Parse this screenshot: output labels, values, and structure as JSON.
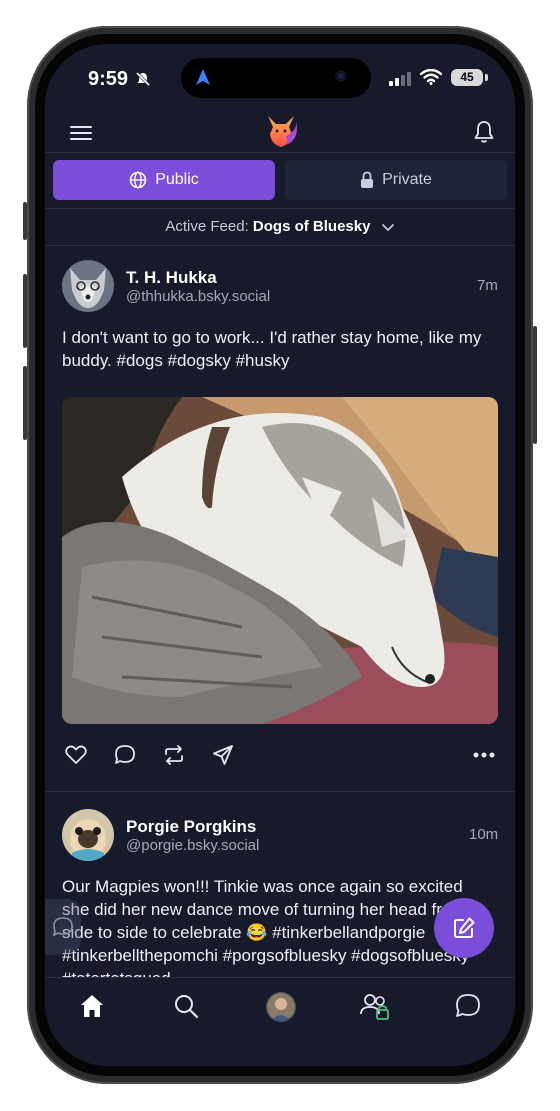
{
  "status_bar": {
    "time": "9:59",
    "battery": "45"
  },
  "header": {
    "logo_icon": "fox-logo-icon",
    "menu_icon": "hamburger-menu-icon",
    "bell_icon": "bell-icon"
  },
  "tabs": [
    {
      "label": "Public",
      "icon": "globe-icon",
      "selected": true
    },
    {
      "label": "Private",
      "icon": "lock-icon",
      "selected": false
    }
  ],
  "feed": {
    "prefix": "Active Feed:",
    "name": "Dogs of Bluesky"
  },
  "posts": [
    {
      "name": "T. H. Hukka",
      "handle": "@thhukka.bsky.social",
      "time": "7m",
      "text": "I don't want to go to work... I'd rather stay home, like my buddy. #dogs #dogsky #husky",
      "image_desc": "husky-sleeping-on-blanket"
    },
    {
      "name": "Porgie Porgkins",
      "handle": "@porgie.bsky.social",
      "time": "10m",
      "text_lines": [
        "Our Magpies won!!! Tinkie was once again so excited",
        "she did her new dance move of turning her head from",
        "side to side to celebrate 😂 #tinkerbellandporgie",
        "#tinkerbellthepomchi #porgsofbluesky #dogsofbluesky",
        "#tatertotsquad"
      ]
    }
  ],
  "actions": [
    "heart-icon",
    "comment-icon",
    "repost-icon",
    "share-icon",
    "more-icon"
  ],
  "bottom_nav": [
    "home-icon",
    "search-icon",
    "profile-avatar",
    "people-icon",
    "chat-icon"
  ],
  "colors": {
    "accent": "#7c4dd8",
    "background": "#161a2b"
  }
}
